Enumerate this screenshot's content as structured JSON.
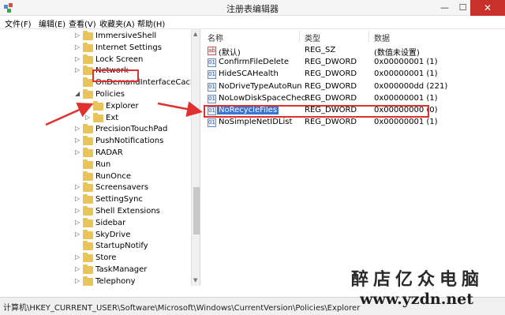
{
  "window": {
    "title": "注册表编辑器",
    "controls": {
      "minimize": "—",
      "maximize": "☐",
      "close": "✕"
    }
  },
  "menu": [
    "文件(F)",
    "编辑(E)",
    "查看(V)",
    "收藏夹(A)",
    "帮助(H)"
  ],
  "tree": {
    "items": [
      {
        "label": "ImmersiveShell",
        "expander": "▷",
        "indent": 1
      },
      {
        "label": "Internet Settings",
        "expander": "▷",
        "indent": 1
      },
      {
        "label": "Lock Screen",
        "expander": "▷",
        "indent": 1
      },
      {
        "label": "Network",
        "expander": "▷",
        "indent": 1
      },
      {
        "label": "OnDemandInterfaceCache",
        "expander": "",
        "indent": 1
      },
      {
        "label": "Policies",
        "expander": "◢",
        "indent": 1
      },
      {
        "label": "Explorer",
        "expander": "",
        "indent": 2,
        "selected": true
      },
      {
        "label": "Ext",
        "expander": "▷",
        "indent": 2
      },
      {
        "label": "PrecisionTouchPad",
        "expander": "▷",
        "indent": 1
      },
      {
        "label": "PushNotifications",
        "expander": "▷",
        "indent": 1
      },
      {
        "label": "RADAR",
        "expander": "▷",
        "indent": 1
      },
      {
        "label": "Run",
        "expander": "",
        "indent": 1
      },
      {
        "label": "RunOnce",
        "expander": "",
        "indent": 1
      },
      {
        "label": "Screensavers",
        "expander": "▷",
        "indent": 1
      },
      {
        "label": "SettingSync",
        "expander": "▷",
        "indent": 1
      },
      {
        "label": "Shell Extensions",
        "expander": "▷",
        "indent": 1
      },
      {
        "label": "Sidebar",
        "expander": "▷",
        "indent": 1
      },
      {
        "label": "SkyDrive",
        "expander": "▷",
        "indent": 1
      },
      {
        "label": "StartupNotify",
        "expander": "",
        "indent": 1
      },
      {
        "label": "Store",
        "expander": "▷",
        "indent": 1
      },
      {
        "label": "TaskManager",
        "expander": "▷",
        "indent": 1
      },
      {
        "label": "Telephony",
        "expander": "▷",
        "indent": 1
      }
    ]
  },
  "list": {
    "headers": {
      "name": "名称",
      "type": "类型",
      "data": "数据"
    },
    "rows": [
      {
        "name": "(默认)",
        "type": "REG_SZ",
        "data": "(数值未设置)",
        "icon": "ab"
      },
      {
        "name": "ConfirmFileDelete",
        "type": "REG_DWORD",
        "data": "0x00000001 (1)",
        "icon": "01"
      },
      {
        "name": "HideSCAHealth",
        "type": "REG_DWORD",
        "data": "0x00000001 (1)",
        "icon": "01"
      },
      {
        "name": "NoDriveTypeAutoRun",
        "type": "REG_DWORD",
        "data": "0x000000dd (221)",
        "icon": "01"
      },
      {
        "name": "NoLowDiskSpaceChec...",
        "type": "REG_DWORD",
        "data": "0x00000001 (1)",
        "icon": "01"
      },
      {
        "name": "NoRecycleFiles",
        "type": "REG_DWORD",
        "data": "0x00000000 (0)",
        "icon": "01",
        "highlight": true
      },
      {
        "name": "NoSimpleNetIDList",
        "type": "REG_DWORD",
        "data": "0x00000001 (1)",
        "icon": "01"
      }
    ]
  },
  "status": {
    "path": "计算机\\HKEY_CURRENT_USER\\Software\\Microsoft\\Windows\\CurrentVersion\\Policies\\Explorer"
  },
  "watermark": {
    "cn": "醉店亿众电脑",
    "url": "www.yzdn.net"
  },
  "colors": {
    "annotation": "#e03030",
    "selection": "#3875d7",
    "folder": "#e9c45b"
  },
  "icons": {
    "app": "regedit-icon",
    "value_string": "string-value-icon",
    "value_dword": "dword-value-icon"
  }
}
